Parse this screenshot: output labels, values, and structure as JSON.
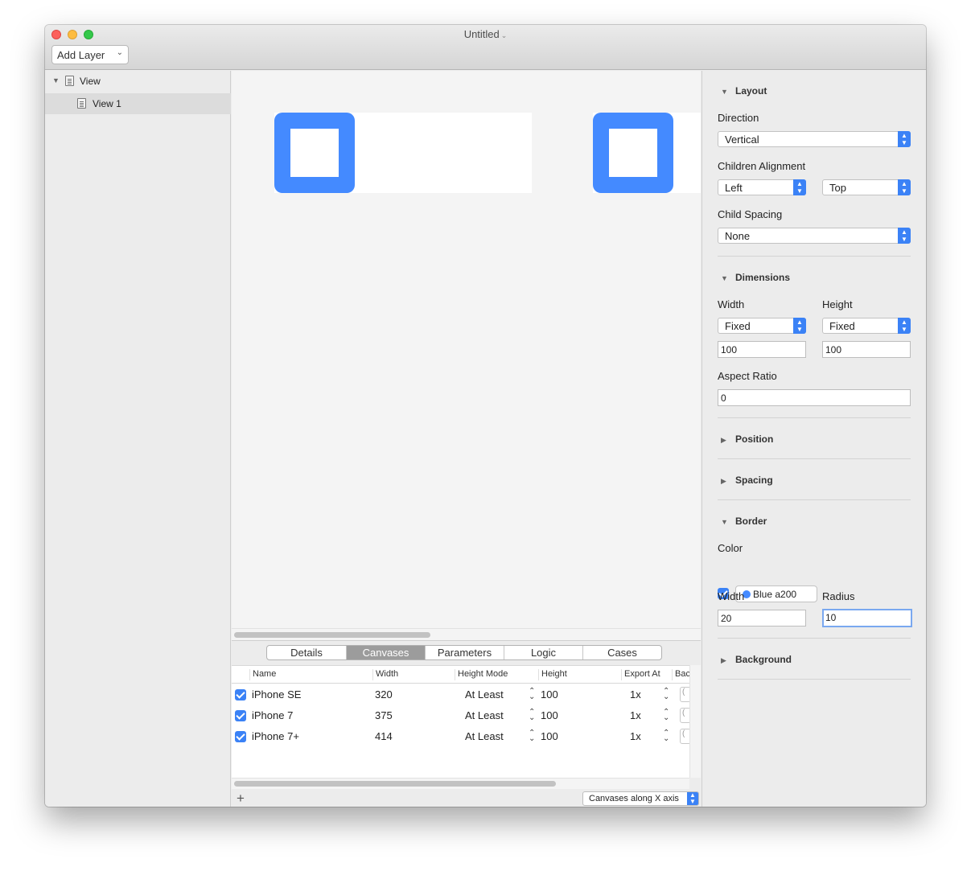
{
  "window": {
    "title": "Untitled"
  },
  "toolbar": {
    "add_layer_label": "Add Layer"
  },
  "layers": [
    {
      "label": "View"
    },
    {
      "label": "View 1"
    }
  ],
  "canvas": {
    "border_color": "#448aff"
  },
  "bottom": {
    "tabs": [
      "Details",
      "Canvases",
      "Parameters",
      "Logic",
      "Cases"
    ],
    "active_tab": "Canvases",
    "columns": [
      "Name",
      "Width",
      "Height Mode",
      "Height",
      "Export At",
      "Bac"
    ],
    "rows": [
      {
        "name": "iPhone SE",
        "width": "320",
        "height_mode": "At Least",
        "height": "100",
        "export_at": "1x"
      },
      {
        "name": "iPhone 7",
        "width": "375",
        "height_mode": "At Least",
        "height": "100",
        "export_at": "1x"
      },
      {
        "name": "iPhone 7+",
        "width": "414",
        "height_mode": "At Least",
        "height": "100",
        "export_at": "1x"
      }
    ],
    "add_label": "+",
    "layout_select": "Canvases along X axis"
  },
  "inspector": {
    "layout": {
      "title": "Layout",
      "direction_label": "Direction",
      "direction_value": "Vertical",
      "children_alignment_label": "Children Alignment",
      "align_h": "Left",
      "align_v": "Top",
      "child_spacing_label": "Child Spacing",
      "child_spacing_value": "None"
    },
    "dimensions": {
      "title": "Dimensions",
      "width_label": "Width",
      "height_label": "Height",
      "width_mode": "Fixed",
      "height_mode": "Fixed",
      "width_value": "100",
      "height_value": "100",
      "aspect_ratio_label": "Aspect Ratio",
      "aspect_ratio_value": "0"
    },
    "position": {
      "title": "Position"
    },
    "spacing": {
      "title": "Spacing"
    },
    "border": {
      "title": "Border",
      "color_label": "Color",
      "color_value": "Blue a200",
      "width_label": "Width",
      "radius_label": "Radius",
      "width_value": "20",
      "radius_value": "10"
    },
    "background": {
      "title": "Background"
    }
  }
}
